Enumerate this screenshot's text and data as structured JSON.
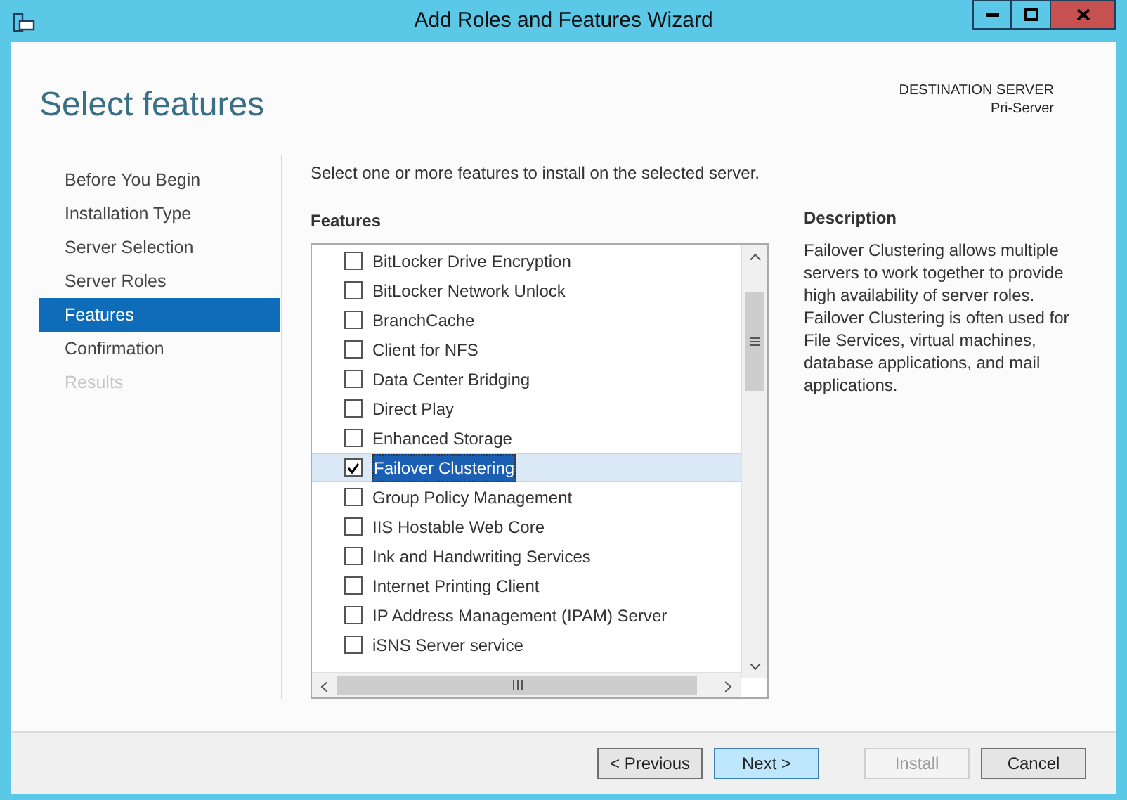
{
  "window": {
    "title": "Add Roles and Features Wizard"
  },
  "page_title": "Select features",
  "destination": {
    "label": "DESTINATION SERVER",
    "server": "Pri-Server"
  },
  "steps": [
    {
      "label": "Before You Begin",
      "selected": false,
      "disabled": false
    },
    {
      "label": "Installation Type",
      "selected": false,
      "disabled": false
    },
    {
      "label": "Server Selection",
      "selected": false,
      "disabled": false
    },
    {
      "label": "Server Roles",
      "selected": false,
      "disabled": false
    },
    {
      "label": "Features",
      "selected": true,
      "disabled": false
    },
    {
      "label": "Confirmation",
      "selected": false,
      "disabled": false
    },
    {
      "label": "Results",
      "selected": false,
      "disabled": true
    }
  ],
  "instruction": "Select one or more features to install on the selected server.",
  "features": {
    "heading": "Features",
    "items": [
      {
        "label": "BitLocker Drive Encryption",
        "checked": false,
        "selected": false
      },
      {
        "label": "BitLocker Network Unlock",
        "checked": false,
        "selected": false
      },
      {
        "label": "BranchCache",
        "checked": false,
        "selected": false
      },
      {
        "label": "Client for NFS",
        "checked": false,
        "selected": false
      },
      {
        "label": "Data Center Bridging",
        "checked": false,
        "selected": false
      },
      {
        "label": "Direct Play",
        "checked": false,
        "selected": false
      },
      {
        "label": "Enhanced Storage",
        "checked": false,
        "selected": false
      },
      {
        "label": "Failover Clustering",
        "checked": true,
        "selected": true
      },
      {
        "label": "Group Policy Management",
        "checked": false,
        "selected": false
      },
      {
        "label": "IIS Hostable Web Core",
        "checked": false,
        "selected": false
      },
      {
        "label": "Ink and Handwriting Services",
        "checked": false,
        "selected": false
      },
      {
        "label": "Internet Printing Client",
        "checked": false,
        "selected": false
      },
      {
        "label": "IP Address Management (IPAM) Server",
        "checked": false,
        "selected": false
      },
      {
        "label": "iSNS Server service",
        "checked": false,
        "selected": false
      }
    ]
  },
  "description": {
    "heading": "Description",
    "text": "Failover Clustering allows multiple servers to work together to provide high availability of server roles. Failover Clustering is often used for File Services, virtual machines, database applications, and mail applications."
  },
  "buttons": [
    {
      "label": "< Previous",
      "default": false,
      "disabled": false
    },
    {
      "label": "Next >",
      "default": true,
      "disabled": false
    },
    {
      "label": "Install",
      "default": false,
      "disabled": true
    },
    {
      "label": "Cancel",
      "default": false,
      "disabled": false
    }
  ]
}
